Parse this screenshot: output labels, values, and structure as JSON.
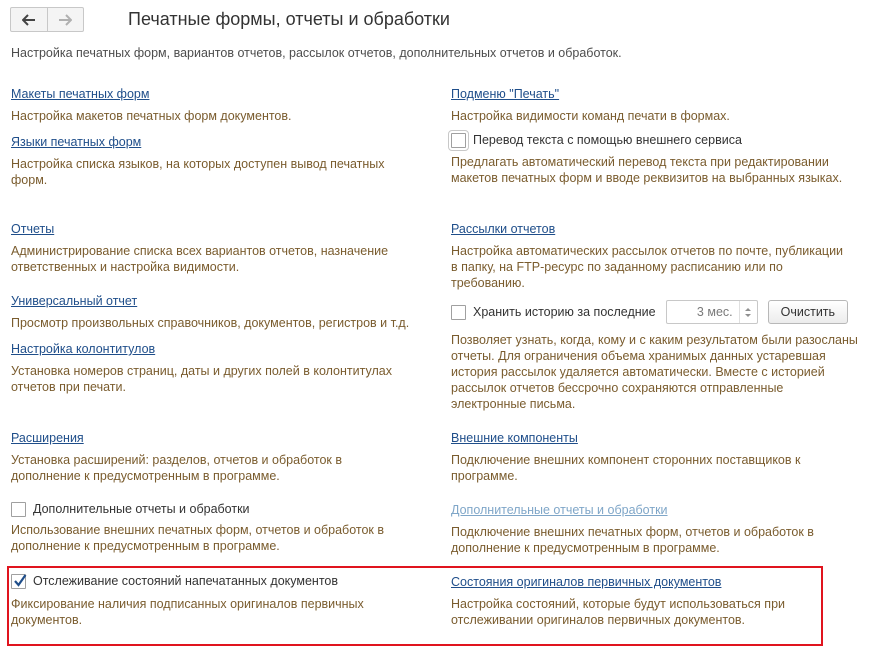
{
  "header": {
    "title": "Печатные формы, отчеты и обработки",
    "description": "Настройка печатных форм, вариантов отчетов, рассылок отчетов, дополнительных отчетов и обработок."
  },
  "left": {
    "print_form_templates": {
      "link": "Макеты печатных форм",
      "desc": "Настройка макетов печатных форм документов."
    },
    "print_form_languages": {
      "link": "Языки печатных форм",
      "desc": "Настройка списка языков, на которых доступен вывод печатных форм."
    },
    "reports": {
      "link": "Отчеты",
      "desc": "Администрирование списка всех вариантов отчетов, назначение ответственных и настройка видимости."
    },
    "universal_report": {
      "link": "Универсальный отчет",
      "desc": "Просмотр произвольных справочников, документов, регистров и т.д."
    },
    "headers_footers": {
      "link": "Настройка колонтитулов",
      "desc": "Установка номеров страниц, даты и других полей в колонтитулах отчетов при печати."
    },
    "extensions": {
      "link": "Расширения",
      "desc": "Установка расширений: разделов, отчетов и обработок в дополнение к предусмотренным в программе."
    },
    "additional_reports": {
      "label": "Дополнительные отчеты и обработки",
      "checked": false,
      "desc": "Использование внешних печатных форм, отчетов и обработок в дополнение к предусмотренным в программе."
    },
    "unprinted_tracking": {
      "label": "Отслеживание состояний напечатанных документов",
      "checked": true,
      "desc": "Фиксирование наличия подписанных оригиналов первичных документов."
    }
  },
  "right": {
    "print_substitution": {
      "link": "Подменю \"Печать\"",
      "desc": "Настройка видимости команд печати в формах."
    },
    "translation": {
      "label": "Перевод текста с помощью внешнего сервиса",
      "checked": false,
      "desc": "Предлагать автоматический перевод текста при редактировании макетов печатных форм и вводе реквизитов на выбранных языках."
    },
    "mailings": {
      "link": "Рассылки отчетов",
      "desc": "Настройка автоматических рассылок отчетов по почте, публикации в папку, на FTP-ресурс по заданному расписанию или по требованию."
    },
    "history": {
      "label": "Хранить историю за последние",
      "checked": false,
      "period_value": "3 мес.",
      "clear_button": "Очистить",
      "desc": "Позволяет узнать, когда, кому и с каким результатом были разосланы отчеты. Для ограничения объема хранимых данных устаревшая история рассылок удаляется автоматически. Вместе с историей рассылок отчетов бессрочно сохраняются отправленные электронные письма."
    },
    "external_components": {
      "link": "Внешние компоненты",
      "desc": "Подключение внешних компонент сторонних поставщиков к программе."
    },
    "additional_reports": {
      "link": "Дополнительные отчеты и обработки",
      "desc": "Подключение внешних печатных форм, отчетов и обработок в дополнение к предусмотренным в программе."
    },
    "original_states": {
      "link": "Состояния оригиналов первичных документов",
      "desc": "Настройка состояний, которые будут использоваться при отслеживании оригиналов первичных документов."
    }
  },
  "colors": {
    "link": "#1f4e8a",
    "link_disabled": "#7fa6c8",
    "description": "#7a5c2e",
    "highlight_border": "#e0141e"
  },
  "icons": [
    "arrow-left-icon",
    "arrow-right-icon",
    "checkmark-icon"
  ]
}
